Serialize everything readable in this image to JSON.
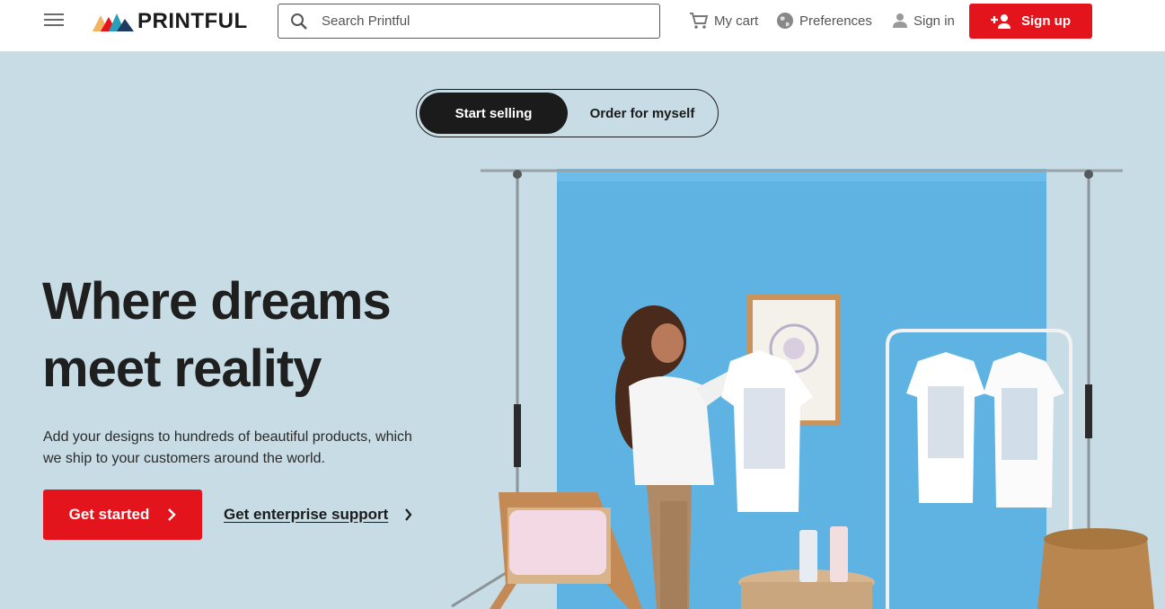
{
  "header": {
    "brand": "PRINTFUL",
    "search_placeholder": "Search Printful",
    "cart_label": "My cart",
    "preferences_label": "Preferences",
    "signin_label": "Sign in",
    "signup_label": "Sign up"
  },
  "hero": {
    "toggle": {
      "active": "Start selling",
      "inactive": "Order for myself"
    },
    "headline_line1": "Where dreams",
    "headline_line2": "meet reality",
    "subtext": "Add your designs to hundreds of beautiful products, which we ship to your customers around the world.",
    "primary_cta": "Get started",
    "secondary_cta": "Get enterprise support"
  },
  "colors": {
    "brand_red": "#e3141b",
    "hero_bg": "#c7dce5",
    "backdrop_blue": "#5fb3e3",
    "text_dark": "#1b1b1b"
  },
  "icons": [
    "menu-icon",
    "printful-logo",
    "search-icon",
    "cart-icon",
    "globe-icon",
    "user-icon",
    "add-user-icon",
    "chevron-right-icon"
  ]
}
